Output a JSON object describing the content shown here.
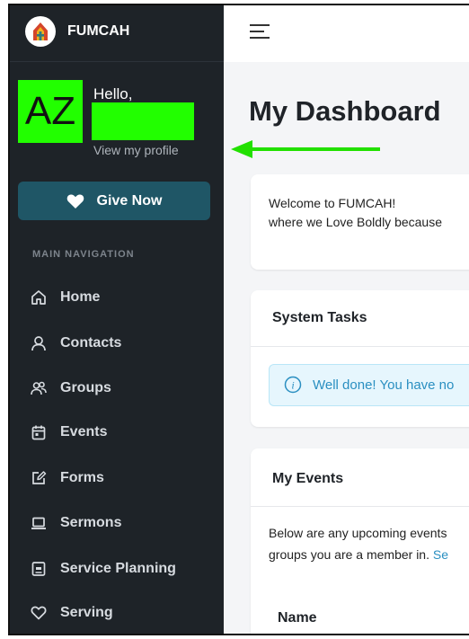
{
  "brand": {
    "name": "FUMCAH"
  },
  "user": {
    "avatar_initials": "AZ",
    "greeting": "Hello,",
    "profile_link": "View my profile"
  },
  "give": {
    "label": "Give Now"
  },
  "nav": {
    "header": "MAIN NAVIGATION",
    "items": [
      {
        "label": "Home",
        "icon": "home-icon"
      },
      {
        "label": "Contacts",
        "icon": "person-icon"
      },
      {
        "label": "Groups",
        "icon": "people-icon"
      },
      {
        "label": "Events",
        "icon": "calendar-icon"
      },
      {
        "label": "Forms",
        "icon": "edit-icon"
      },
      {
        "label": "Sermons",
        "icon": "laptop-icon"
      },
      {
        "label": "Service Planning",
        "icon": "planner-icon"
      },
      {
        "label": "Serving",
        "icon": "heart-icon"
      }
    ]
  },
  "main": {
    "title": "My Dashboard",
    "welcome": {
      "line1": "Welcome to FUMCAH!",
      "line2": "where we Love Boldly because"
    },
    "system_tasks": {
      "title": "System Tasks",
      "alert": "Well done! You have no"
    },
    "my_events": {
      "title": "My Events",
      "line1": "Below are any upcoming events",
      "line2": "groups you are a member in.",
      "link": "Se",
      "column_name": "Name"
    }
  },
  "colors": {
    "sidebar_bg": "#1e2328",
    "accent_button": "#1f5666",
    "highlight_green": "#22ff00",
    "info_blue": "#2a8fc1"
  }
}
